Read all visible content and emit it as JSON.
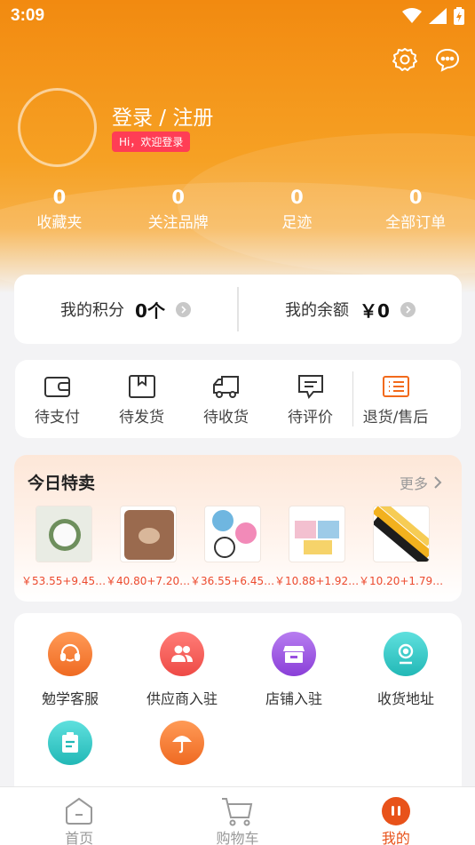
{
  "status_bar": {
    "time": "3:09"
  },
  "profile": {
    "login_label": "登录 / 注册",
    "welcome_badge": "Hi，欢迎登录"
  },
  "stats": [
    {
      "count": "0",
      "label": "收藏夹"
    },
    {
      "count": "0",
      "label": "关注品牌"
    },
    {
      "count": "0",
      "label": "足迹"
    },
    {
      "count": "0",
      "label": "全部订单"
    }
  ],
  "wallet": {
    "points_label": "我的积分",
    "points_value": "0个",
    "balance_label": "我的余额",
    "balance_value": "￥0"
  },
  "orders": [
    {
      "label": "待支付",
      "icon": "wallet-icon"
    },
    {
      "label": "待发货",
      "icon": "package-icon"
    },
    {
      "label": "待收货",
      "icon": "truck-icon"
    },
    {
      "label": "待评价",
      "icon": "comment-icon"
    },
    {
      "label": "退货/售后",
      "icon": "list-icon"
    }
  ],
  "daily_deals": {
    "title": "今日特卖",
    "more_label": "更多",
    "products": [
      {
        "price": "￥53.55+9.45…"
      },
      {
        "price": "￥40.80+7.20…"
      },
      {
        "price": "￥36.55+6.45…"
      },
      {
        "price": "￥10.88+1.92…"
      },
      {
        "price": "￥10.20+1.79…"
      }
    ]
  },
  "services": [
    {
      "label": "勉学客服",
      "icon": "headset-icon",
      "color": "#f2772c"
    },
    {
      "label": "供应商入驻",
      "icon": "users-icon",
      "color": "#f1564f"
    },
    {
      "label": "店铺入驻",
      "icon": "shop-icon",
      "color": "#9a4fe0"
    },
    {
      "label": "收货地址",
      "icon": "location-icon",
      "color": "#2cc6c4"
    },
    {
      "label": "",
      "icon": "clipboard-icon",
      "color": "#2cc6c4"
    },
    {
      "label": "",
      "icon": "umbrella-icon",
      "color": "#f2772c"
    }
  ],
  "tabbar": [
    {
      "label": "首页",
      "icon": "home-icon"
    },
    {
      "label": "购物车",
      "icon": "cart-icon"
    },
    {
      "label": "我的",
      "icon": "profile-icon"
    }
  ],
  "colors": {
    "brand_orange": "#f28a10",
    "price_red": "#ec4a2e",
    "active_tab": "#e8521a"
  }
}
